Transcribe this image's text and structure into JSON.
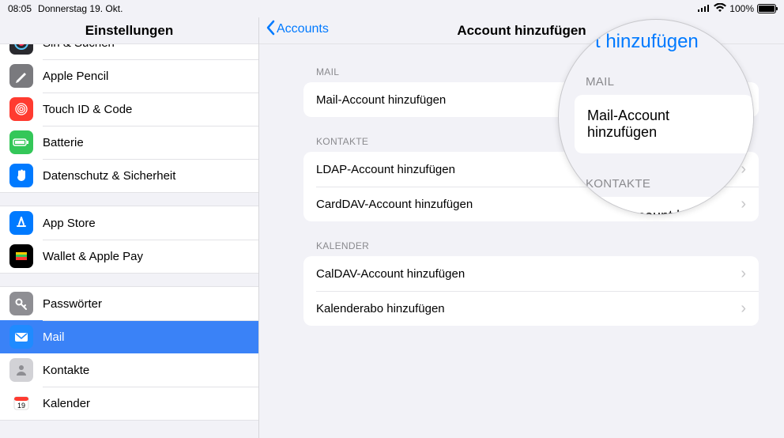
{
  "status": {
    "time": "08:05",
    "date": "Donnerstag 19. Okt.",
    "battery_pct": "100%"
  },
  "sidebar": {
    "title": "Einstellungen",
    "groups": [
      {
        "items": [
          {
            "label": "Siri & Suchen",
            "icon_bg": "#2a2a2f",
            "icon": "siri"
          },
          {
            "label": "Apple Pencil",
            "icon_bg": "#7a7a7e",
            "icon": "pencil"
          },
          {
            "label": "Touch ID & Code",
            "icon_bg": "#ff3b30",
            "icon": "fingerprint"
          },
          {
            "label": "Batterie",
            "icon_bg": "#34c759",
            "icon": "battery"
          },
          {
            "label": "Datenschutz & Sicherheit",
            "icon_bg": "#007aff",
            "icon": "hand"
          }
        ]
      },
      {
        "items": [
          {
            "label": "App Store",
            "icon_bg": "#007aff",
            "icon": "appstore"
          },
          {
            "label": "Wallet & Apple Pay",
            "icon_bg": "#000000",
            "icon": "wallet"
          }
        ]
      },
      {
        "items": [
          {
            "label": "Passwörter",
            "icon_bg": "#8e8e93",
            "icon": "key"
          },
          {
            "label": "Mail",
            "icon_bg": "#1f8bff",
            "icon": "mail",
            "selected": true
          },
          {
            "label": "Kontakte",
            "icon_bg": "#d2d2d6",
            "icon": "contacts"
          },
          {
            "label": "Kalender",
            "icon_bg": "#ffffff",
            "icon": "calendar"
          }
        ]
      }
    ]
  },
  "detail": {
    "back_label": "Accounts",
    "title": "Account hinzufügen",
    "sections": [
      {
        "header": "MAIL",
        "rows": [
          {
            "label": "Mail-Account hinzufügen"
          }
        ]
      },
      {
        "header": "KONTAKTE",
        "rows": [
          {
            "label": "LDAP-Account hinzufügen"
          },
          {
            "label": "CardDAV-Account hinzufügen"
          }
        ]
      },
      {
        "header": "KALENDER",
        "rows": [
          {
            "label": "CalDAV-Account hinzufügen"
          },
          {
            "label": "Kalenderabo hinzufügen"
          }
        ]
      }
    ]
  },
  "magnifier": {
    "top_title": "t hinzufügen",
    "section1": "MAIL",
    "row1": "Mail-Account hinzufügen",
    "section2": "KONTAKTE",
    "row2": "DAP-Account hinzufü"
  }
}
